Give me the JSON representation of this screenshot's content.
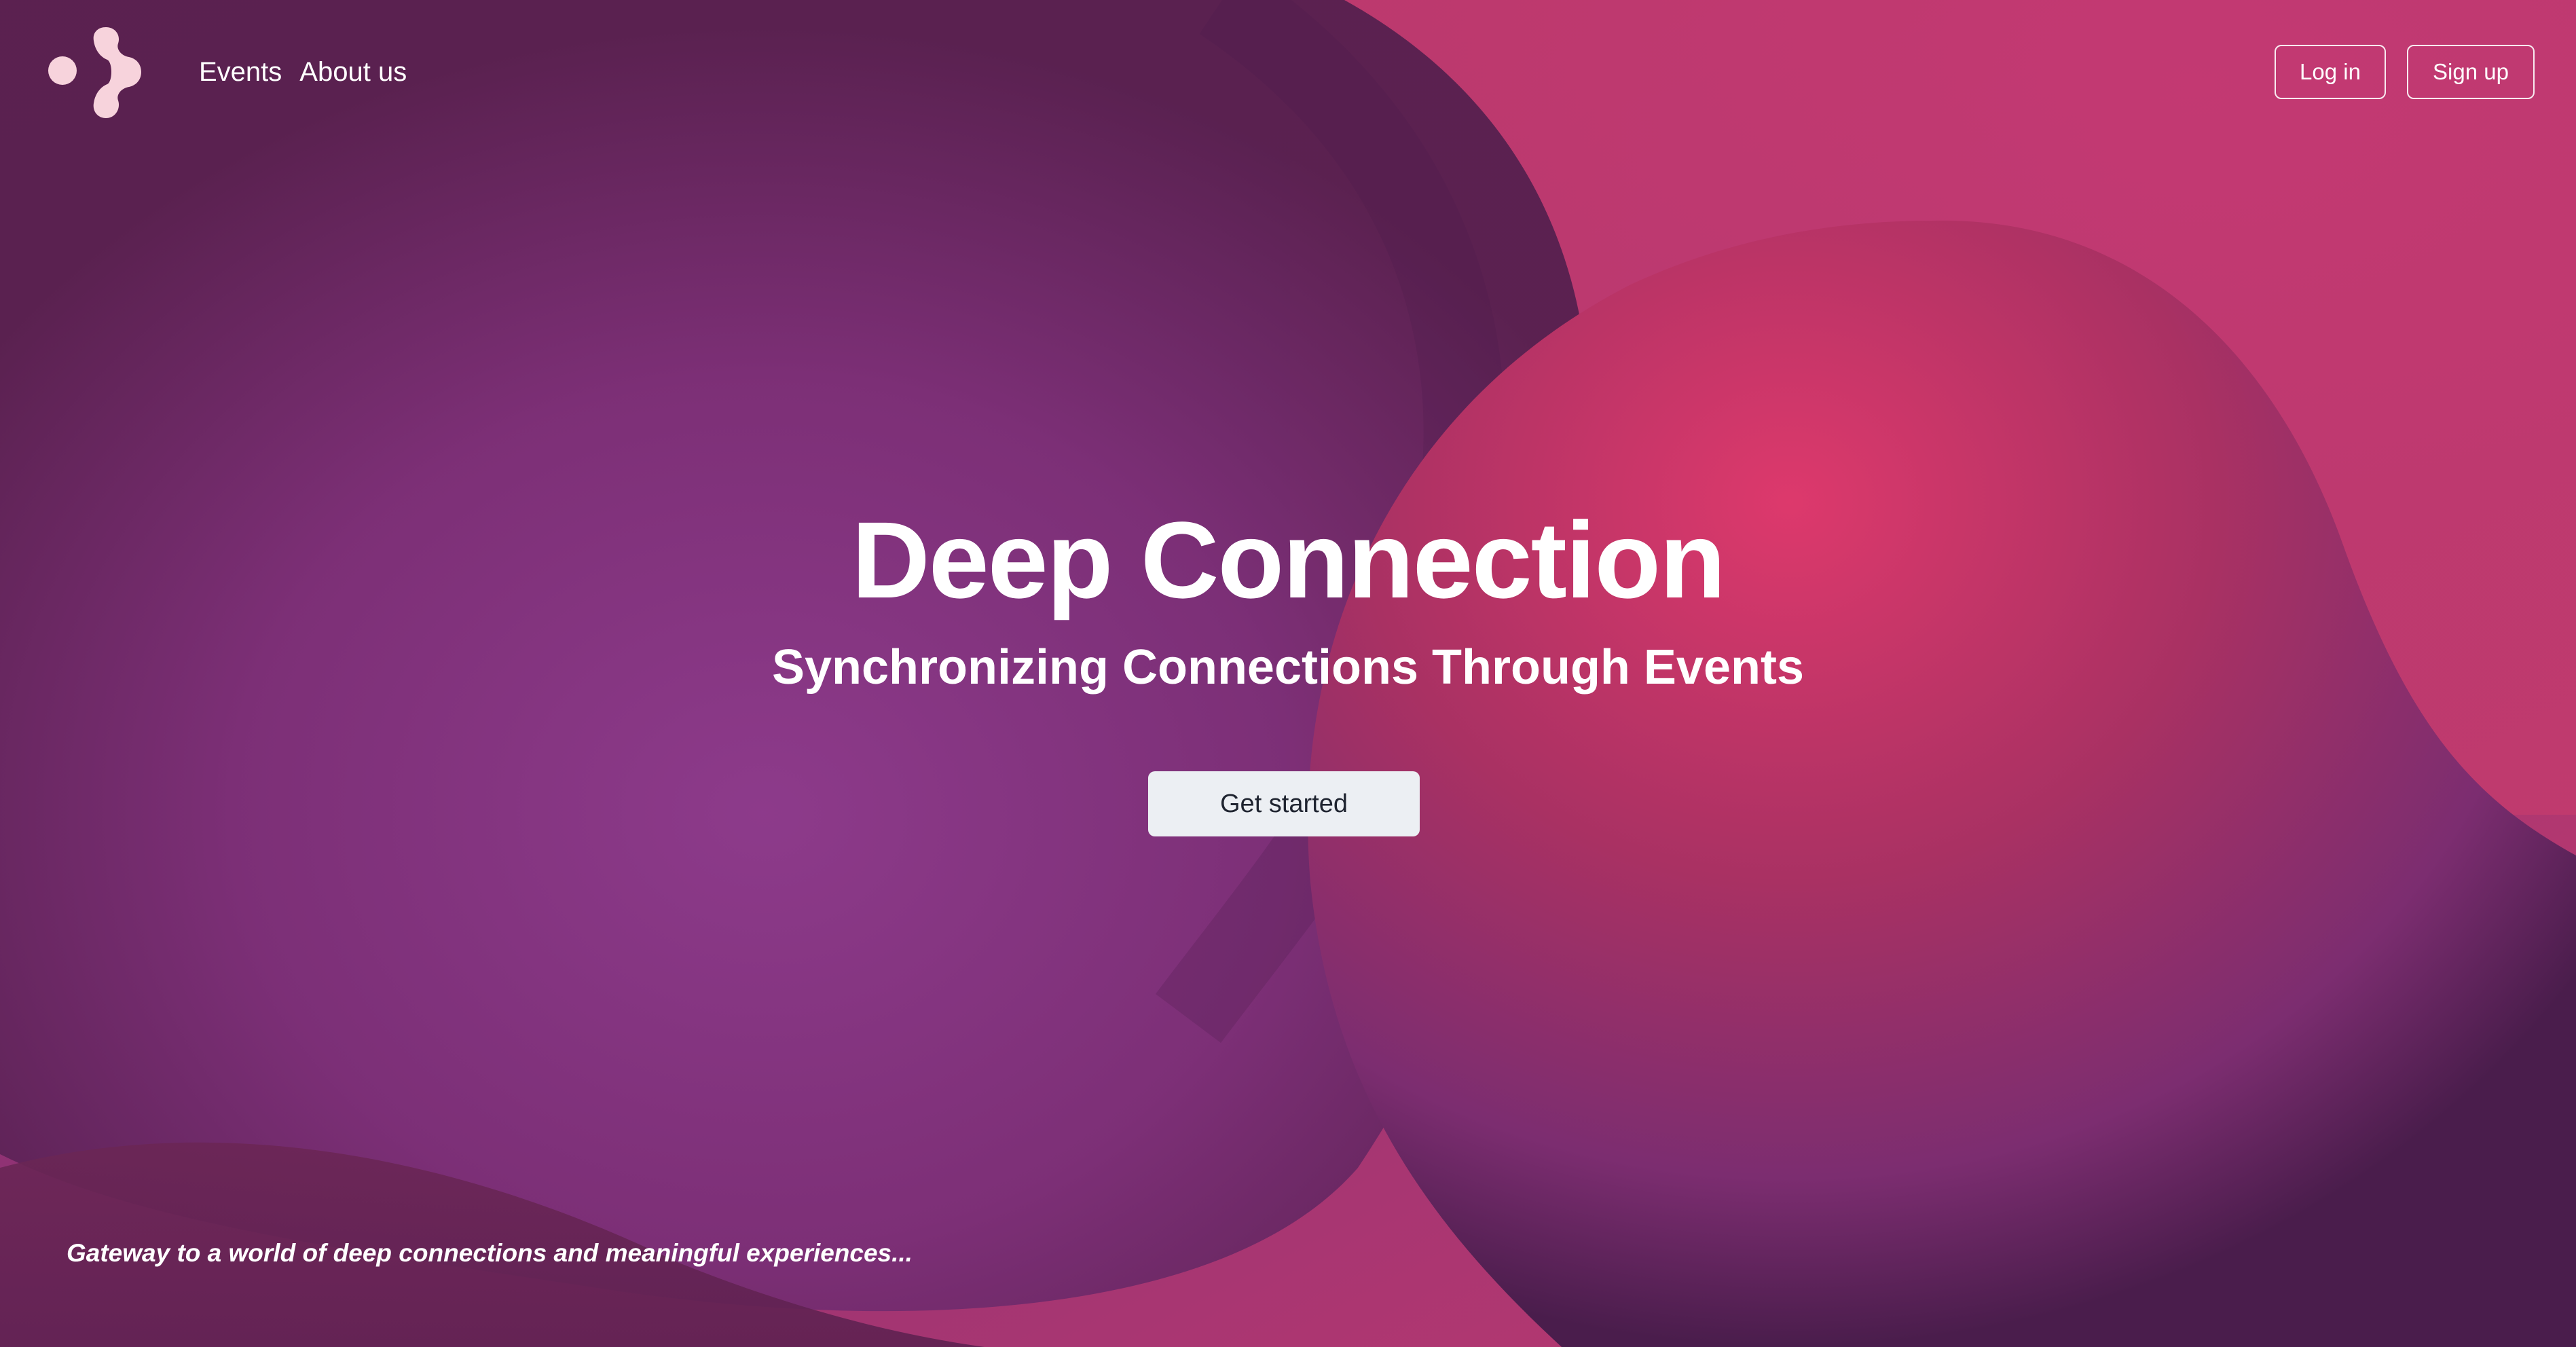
{
  "nav": {
    "events": "Events",
    "about": "About us"
  },
  "auth": {
    "login": "Log in",
    "signup": "Sign up"
  },
  "hero": {
    "title": "Deep Connection",
    "subtitle": "Synchronizing Connections Through Events",
    "cta": "Get started"
  },
  "tagline": "Gateway to a world of deep connections and meaningful experiences...",
  "icons": {
    "logo": "connected-nodes-logo-icon"
  },
  "colors": {
    "background_pink": "#c4396f",
    "background_purple": "#873b8a",
    "deep_plum": "#5a2255",
    "hot_pink_glow": "#dc3a6c",
    "logo_fill": "#f7d3dc",
    "cta_background": "#eceff3",
    "cta_text": "#1f2430"
  }
}
